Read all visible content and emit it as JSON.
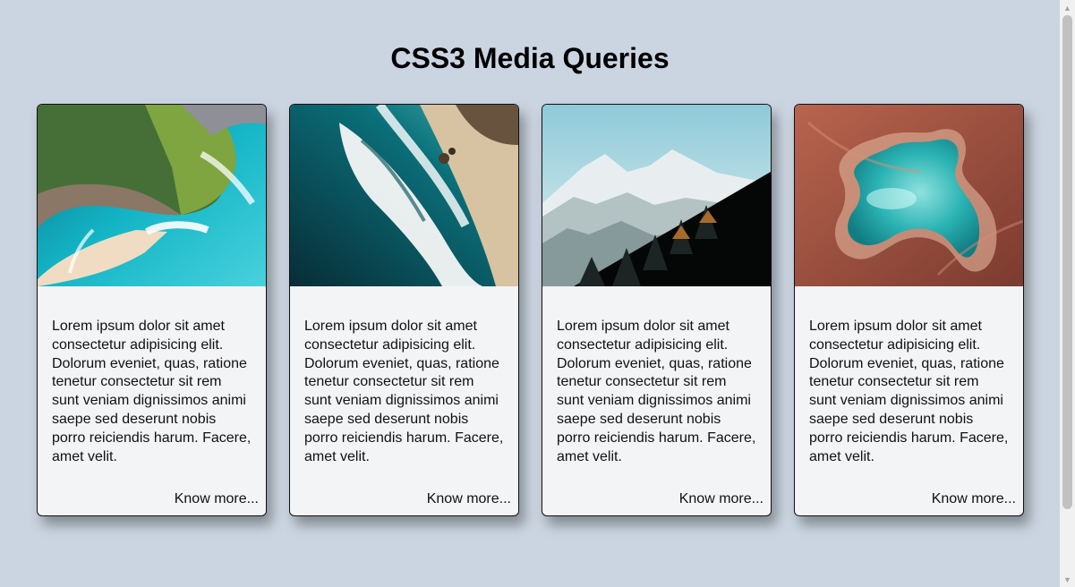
{
  "page": {
    "title": "CSS3 Media Queries"
  },
  "cards": [
    {
      "image_icon": "cliff-beach-image",
      "text": "Lorem ipsum dolor sit amet consectetur adipisicing elit. Dolorum eveniet, quas, ratione tenetur consectetur sit rem sunt veniam dignissimos animi saepe sed deserunt nobis porro reiciendis harum. Facere, amet velit.",
      "link": "Know more..."
    },
    {
      "image_icon": "ocean-shore-image",
      "text": "Lorem ipsum dolor sit amet consectetur adipisicing elit. Dolorum eveniet, quas, ratione tenetur consectetur sit rem sunt veniam dignissimos animi saepe sed deserunt nobis porro reiciendis harum. Facere, amet velit.",
      "link": "Know more..."
    },
    {
      "image_icon": "mountain-forest-image",
      "text": "Lorem ipsum dolor sit amet consectetur adipisicing elit. Dolorum eveniet, quas, ratione tenetur consectetur sit rem sunt veniam dignissimos animi saepe sed deserunt nobis porro reiciendis harum. Facere, amet velit.",
      "link": "Know more..."
    },
    {
      "image_icon": "desert-lake-image",
      "text": "Lorem ipsum dolor sit amet consectetur adipisicing elit. Dolorum eveniet, quas, ratione tenetur consectetur sit rem sunt veniam dignissimos animi saepe sed deserunt nobis porro reiciendis harum. Facere, amet velit.",
      "link": "Know more..."
    }
  ],
  "colors": {
    "background": "#cbd5e1",
    "card_background": "#f3f4f6",
    "text": "#111111"
  }
}
